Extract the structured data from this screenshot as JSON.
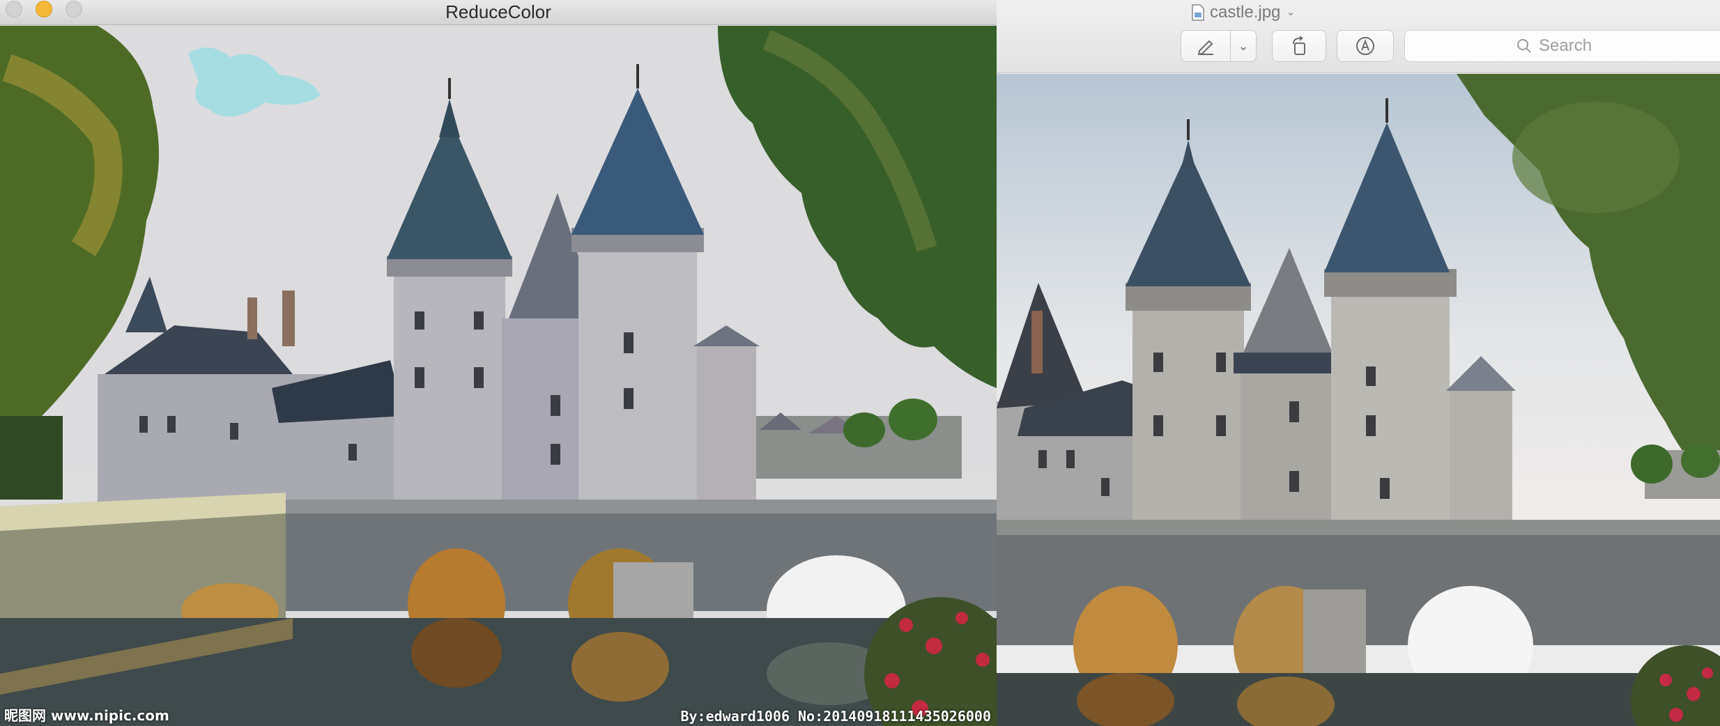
{
  "left_window": {
    "title": "ReduceColor",
    "watermark_left": "昵图网 www.nipic.com",
    "watermark_right": "By:edward1006 No:20140918111435026000"
  },
  "right_window": {
    "document_title": "castle.jpg",
    "document_title_chevron": "chevron-down-icon",
    "toolbar": {
      "markup_tool_icon": "pen-markup-icon",
      "markup_menu_icon": "chevron-down-icon",
      "rotate_icon": "rotate-icon",
      "annotate_icon": "annotate-circle-icon",
      "search_placeholder": "Search"
    }
  },
  "colors": {
    "traffic_light_minimize": "#f4b83b",
    "traffic_light_inactive": "#d3d3d3",
    "reduced_sky": "#dcdcde",
    "original_sky": "#c9d7e4",
    "slate_roof": "#3f5570",
    "stone": "#b4b3ad"
  }
}
